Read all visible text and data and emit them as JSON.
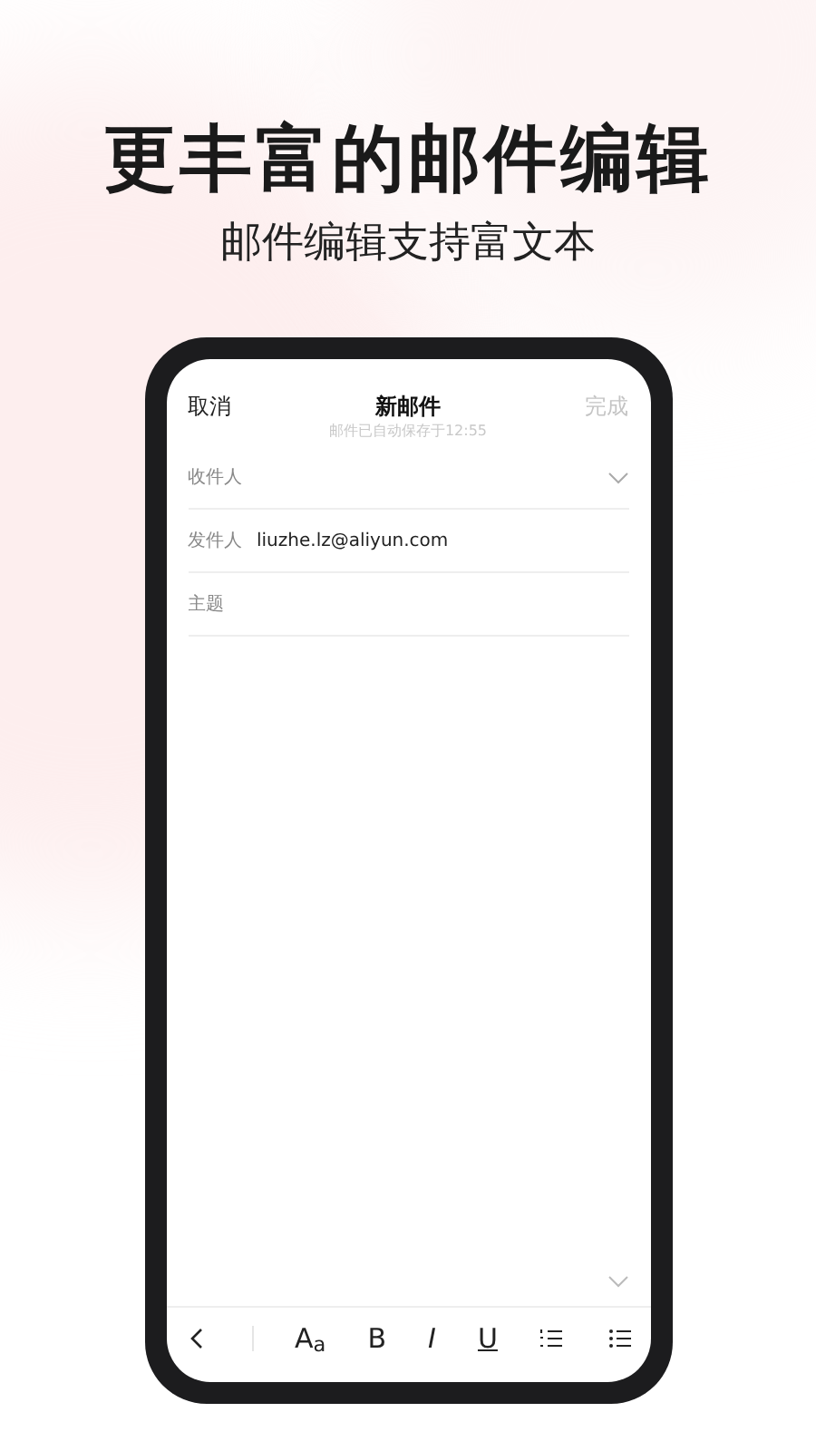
{
  "headline": "更丰富的邮件编辑",
  "subheadline": "邮件编辑支持富文本",
  "compose": {
    "cancel": "取消",
    "title": "新邮件",
    "saved_note": "邮件已自动保存于12:55",
    "done": "完成",
    "done_disabled": true,
    "to_label": "收件人",
    "from_label": "发件人",
    "from_value": "liuzhe.lz@aliyun.com",
    "subject": {
      "placeholder": "主题"
    }
  },
  "toolbar": [
    {
      "kind": "back"
    },
    {
      "kind": "font",
      "label": "A$_{a}$"
    },
    {
      "kind": "bold",
      "label": "B"
    },
    {
      "kind": "italic",
      "label": "I"
    },
    {
      "kind": "underline",
      "label": "U"
    },
    {
      "kind": "numbered-list"
    },
    {
      "kind": "bullet-list"
    }
  ]
}
